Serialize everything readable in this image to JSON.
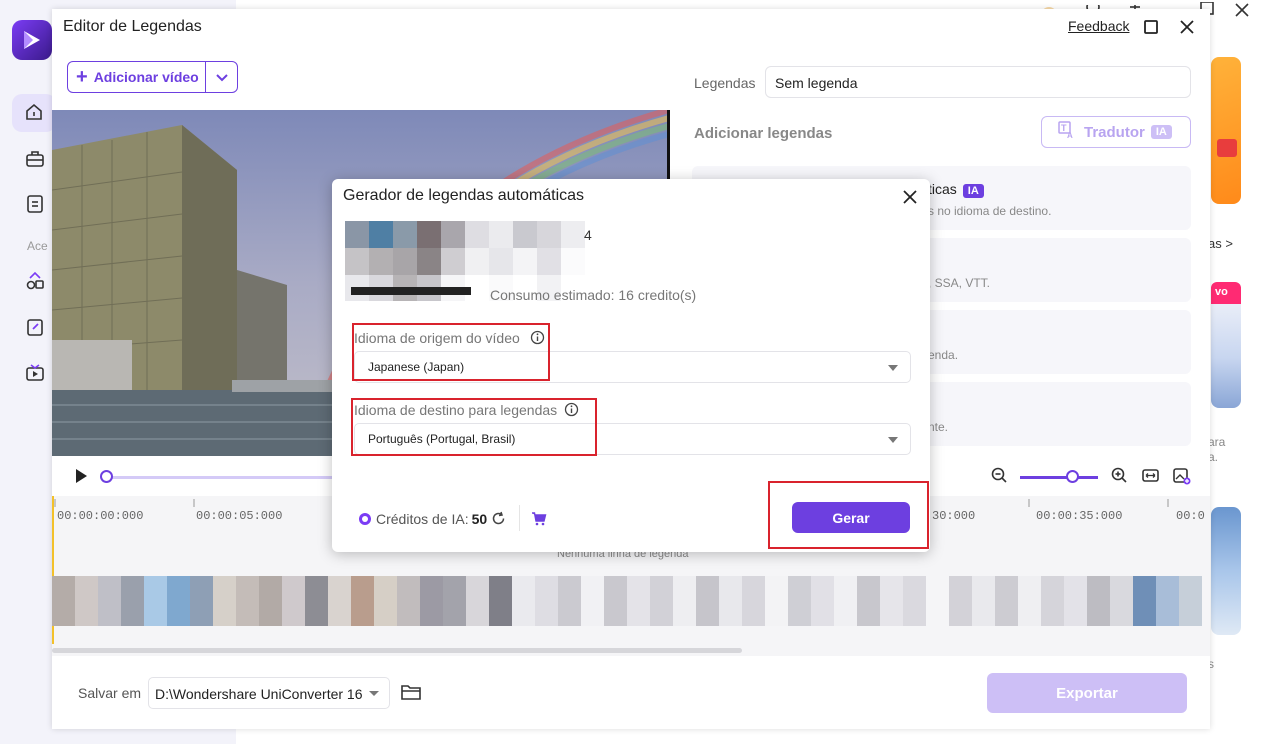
{
  "window": {
    "title": "Editor de Legendas",
    "feedback": "Feedback"
  },
  "background": {
    "nav_label_partial": "Ace",
    "right_text_1": "as >",
    "right_badge": "vo",
    "right_text_2": "ara",
    "right_text_3": "a.",
    "right_text_4": "s"
  },
  "toolbar": {
    "add_video_label": "Adicionar vídeo"
  },
  "right_panel": {
    "subtitles_label": "Legendas",
    "subtitles_value": "Sem legenda",
    "add_subtitles_title": "Adicionar legendas",
    "translator_label": "Tradutor",
    "translator_badge": "IA",
    "cards": [
      {
        "title_partial": "ticas",
        "badge": "IA",
        "desc_partial": "s no idioma de destino."
      },
      {
        "desc_partial": ", SSA, VTT."
      },
      {
        "desc_partial": "enda."
      },
      {
        "desc_partial": "nte."
      }
    ]
  },
  "timeline": {
    "ticks": [
      "00:00:00:000",
      "00:00:05:000",
      "30:000",
      "00:00:35:000",
      "00:0"
    ],
    "empty_text": "Nenhuma linha de legenda"
  },
  "footer": {
    "save_label": "Salvar em",
    "save_path": "D:\\Wondershare UniConverter 16",
    "export_label": "Exportar"
  },
  "modal": {
    "title": "Gerador de legendas automáticas",
    "filename_tail": "4",
    "estimate": "Consumo estimado: 16 credito(s)",
    "source_label": "Idioma de origem do vídeo",
    "source_value": "Japanese (Japan)",
    "target_label": "Idioma de destino para legendas",
    "target_value": "Português (Portugal, Brasil)",
    "credits_label": "Créditos de IA:",
    "credits_value": "50",
    "generate_label": "Gerar"
  },
  "colors": {
    "accent": "#6d3fe0",
    "accent_light": "#cdbff6",
    "highlight": "#d9232d"
  }
}
